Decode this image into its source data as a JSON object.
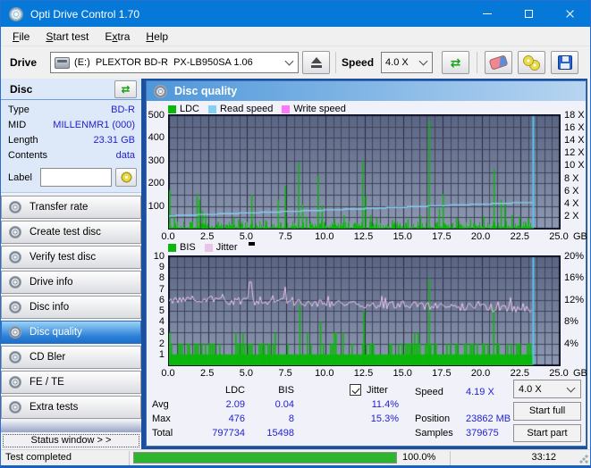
{
  "window": {
    "title": "Opti Drive Control 1.70"
  },
  "menu": {
    "items": [
      {
        "id": "file",
        "pre": "",
        "underline": "F",
        "post": "ile"
      },
      {
        "id": "start-test",
        "pre": "",
        "underline": "S",
        "post": "tart test"
      },
      {
        "id": "extra",
        "pre": "E",
        "underline": "x",
        "post": "tra"
      },
      {
        "id": "help",
        "pre": "",
        "underline": "H",
        "post": "elp"
      }
    ]
  },
  "toolbar": {
    "drive_label": "Drive",
    "drive_value": "(E:)  PLEXTOR BD-R  PX-LB950SA 1.06",
    "speed_label": "Speed",
    "speed_value": "4.0 X"
  },
  "sidebar": {
    "disc_header": "Disc",
    "info": [
      {
        "id": "type",
        "label": "Type",
        "value": "BD-R"
      },
      {
        "id": "mid",
        "label": "MID",
        "value": "MILLENMR1 (000)"
      },
      {
        "id": "length",
        "label": "Length",
        "value": "23.31 GB"
      },
      {
        "id": "contents",
        "label": "Contents",
        "value": "data"
      }
    ],
    "label_field": {
      "label": "Label",
      "value": ""
    },
    "buttons": [
      {
        "id": "transfer-rate",
        "label": "Transfer rate",
        "selected": false
      },
      {
        "id": "create-test-disc",
        "label": "Create test disc",
        "selected": false
      },
      {
        "id": "verify-test-disc",
        "label": "Verify test disc",
        "selected": false
      },
      {
        "id": "drive-info",
        "label": "Drive info",
        "selected": false
      },
      {
        "id": "disc-info",
        "label": "Disc info",
        "selected": false
      },
      {
        "id": "disc-quality",
        "label": "Disc quality",
        "selected": true
      },
      {
        "id": "cd-bler",
        "label": "CD Bler",
        "selected": false
      },
      {
        "id": "fe-te",
        "label": "FE / TE",
        "selected": false
      },
      {
        "id": "extra-tests",
        "label": "Extra tests",
        "selected": false
      }
    ],
    "status_window_button": "Status window > >"
  },
  "panel": {
    "title": "Disc quality"
  },
  "chart_data": [
    {
      "type": "spikes+line",
      "title": "LDC errors vs read/write speed",
      "x": {
        "min": 0,
        "max": 25,
        "unit": "GB",
        "ticks": [
          0,
          2.5,
          5,
          7.5,
          10,
          12.5,
          15,
          17.5,
          20,
          22.5,
          25
        ],
        "tick_labels": [
          "0.0",
          "2.5",
          "5.0",
          "7.5",
          "10.0",
          "12.5",
          "15.0",
          "17.5",
          "20.0",
          "22.5",
          "25.0"
        ]
      },
      "y_left": {
        "min": 0,
        "max": 500,
        "ticks": [
          500,
          400,
          300,
          200,
          100
        ]
      },
      "y_right": {
        "min": 0,
        "max": 18,
        "ticks": [
          18,
          16,
          14,
          12,
          10,
          8,
          6,
          4,
          2
        ],
        "suffix": " X"
      },
      "legend": [
        {
          "label": "LDC",
          "color": "#0cb60c"
        },
        {
          "label": "Read speed",
          "color": "#85cff2"
        },
        {
          "label": "Write speed",
          "color": "#fa78fa"
        }
      ],
      "grid": true,
      "data_end_gb": 23.31,
      "ldc": {
        "noise_max": 32,
        "seed": 20,
        "spikes": [
          [
            0.05,
            170
          ],
          [
            0.35,
            60
          ],
          [
            1.8,
            155
          ],
          [
            1.95,
            128
          ],
          [
            2.15,
            80
          ],
          [
            2.35,
            62
          ],
          [
            4.15,
            48
          ],
          [
            4.45,
            40
          ],
          [
            5.3,
            150
          ],
          [
            6.2,
            38
          ],
          [
            7.0,
            128
          ],
          [
            7.45,
            188
          ],
          [
            8.3,
            293
          ],
          [
            8.55,
            108
          ],
          [
            8.8,
            50
          ],
          [
            9.55,
            233
          ],
          [
            9.8,
            103
          ],
          [
            10.6,
            42
          ],
          [
            11.2,
            58
          ],
          [
            12.4,
            303
          ],
          [
            12.6,
            142
          ],
          [
            12.9,
            60
          ],
          [
            13.3,
            48
          ],
          [
            14.3,
            38
          ],
          [
            15.3,
            42
          ],
          [
            16.1,
            55
          ],
          [
            16.65,
            477
          ],
          [
            17.3,
            88
          ],
          [
            17.55,
            152
          ],
          [
            18.4,
            48
          ],
          [
            19.3,
            42
          ],
          [
            20.15,
            55
          ],
          [
            20.8,
            263
          ],
          [
            21.25,
            128
          ],
          [
            21.5,
            108
          ],
          [
            21.95,
            60
          ],
          [
            22.45,
            55
          ],
          [
            23.0,
            45
          ]
        ]
      },
      "read_speed": {
        "start_x_speed": 2.02,
        "end_x_speed": 4.19,
        "step": 0.125,
        "end_marker_color": "#58c6f0"
      }
    },
    {
      "type": "bars+line",
      "title": "BIS errors vs jitter",
      "x": {
        "min": 0,
        "max": 25,
        "unit": "GB",
        "ticks": [
          0,
          2.5,
          5,
          7.5,
          10,
          12.5,
          15,
          17.5,
          20,
          22.5,
          25
        ],
        "tick_labels": [
          "0.0",
          "2.5",
          "5.0",
          "7.5",
          "10.0",
          "12.5",
          "15.0",
          "17.5",
          "20.0",
          "22.5",
          "25.0"
        ]
      },
      "y_left": {
        "min": 0,
        "max": 10,
        "ticks": [
          10,
          9,
          8,
          7,
          6,
          5,
          4,
          3,
          2,
          1
        ]
      },
      "y_right": {
        "min": 0,
        "max": 20,
        "ticks": [
          20,
          16,
          12,
          8,
          4
        ],
        "suffix": "%"
      },
      "legend": [
        {
          "label": "BIS",
          "color": "#0cb60c"
        },
        {
          "label": "Jitter",
          "color": "#e9c4e9"
        }
      ],
      "grid": true,
      "data_end_gb": 23.31,
      "bis": {
        "baseline": 1,
        "level2_prob": 0.46,
        "level3_prob": 0.05,
        "seed": 7,
        "spikes": [
          [
            8.38,
            5.5
          ],
          [
            9.7,
            4
          ],
          [
            12.47,
            5
          ],
          [
            16.65,
            8
          ],
          [
            20.78,
            5.2
          ]
        ]
      },
      "jitter": {
        "avg_pct": 11.4,
        "max_pct": 15.3,
        "start_pct": 12.15,
        "end_pct": 10.35,
        "noise_pct": 0.75,
        "seed": 99,
        "spikes": [
          [
            5.18,
            15.3
          ],
          [
            7.45,
            14.4
          ]
        ]
      }
    }
  ],
  "stats": {
    "col_ldc": "LDC",
    "col_bis": "BIS",
    "jitter_label": "Jitter",
    "jitter_checked": true,
    "rows": {
      "avg": {
        "label": "Avg",
        "ldc": "2.09",
        "bis": "0.04",
        "jitter": "11.4%"
      },
      "max": {
        "label": "Max",
        "ldc": "476",
        "bis": "8",
        "jitter": "15.3%"
      },
      "total": {
        "label": "Total",
        "ldc": "797734",
        "bis": "15498",
        "jitter": ""
      }
    },
    "right": {
      "speed": {
        "label": "Speed",
        "value": "4.19 X"
      },
      "position": {
        "label": "Position",
        "value": "23862 MB"
      },
      "samples": {
        "label": "Samples",
        "value": "379675"
      }
    },
    "speed_select": "4.0 X",
    "start_full": "Start full",
    "start_part": "Start part"
  },
  "statusbar": {
    "status": "Test completed",
    "progress_pct": 100,
    "progress_text": "100.0%",
    "time": "33:12"
  },
  "colors": {
    "titlebar": "#0679d8",
    "accent_navy": "#1c509f",
    "value_blue": "#2222cf",
    "progress_green": "#2eb52e",
    "selected_button": "#2b80d7",
    "end_marker": "#58c6f0"
  }
}
